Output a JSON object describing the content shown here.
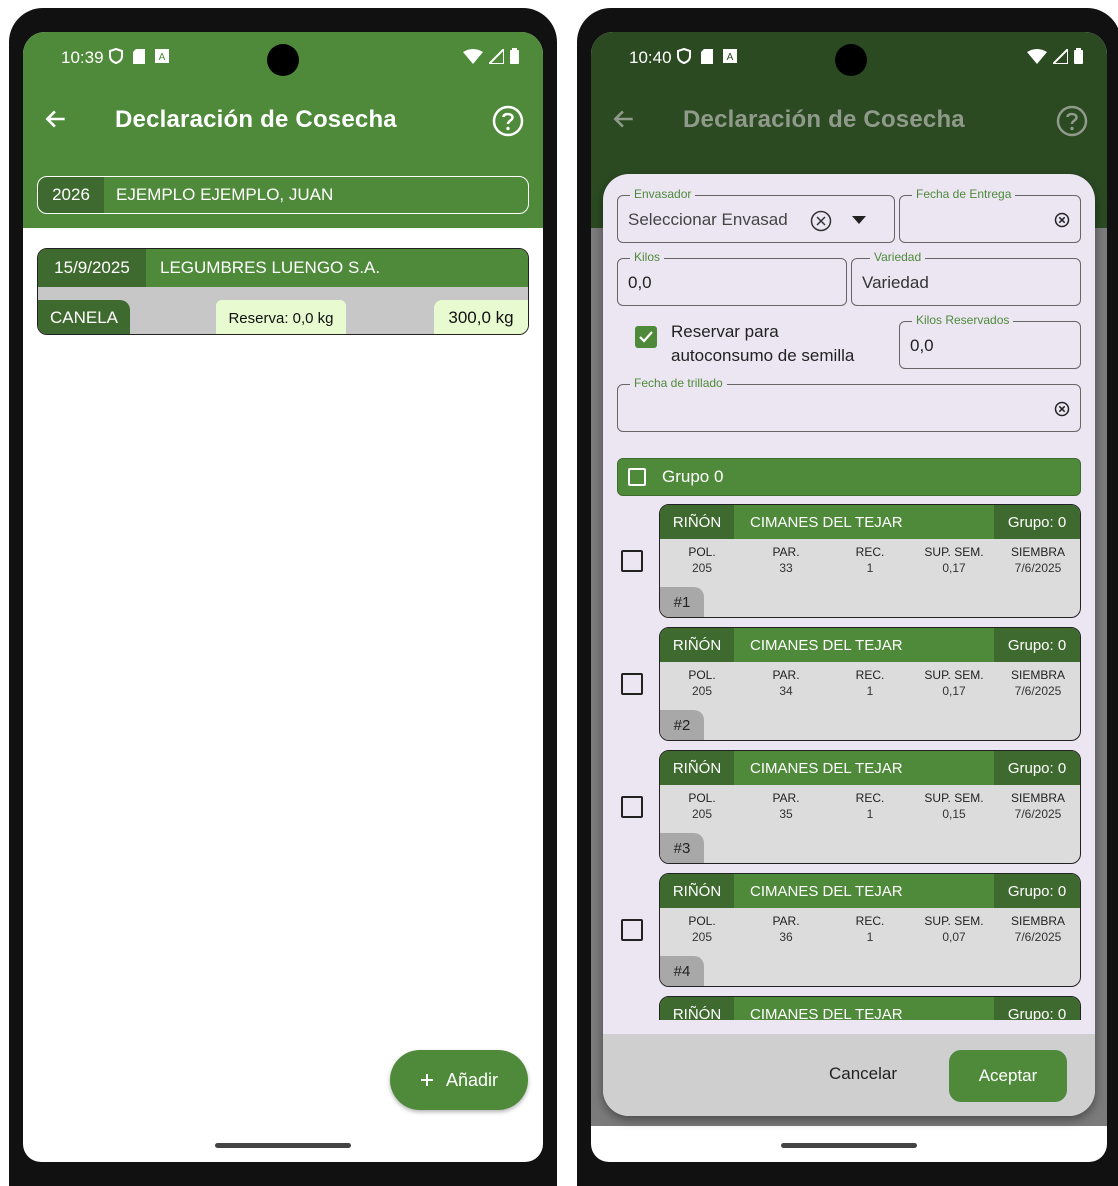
{
  "left": {
    "status": {
      "time": "10:39"
    },
    "appbar": {
      "title": "Declaración de Cosecha"
    },
    "campaign": {
      "year": "2026",
      "holder": "EJEMPLO EJEMPLO, JUAN"
    },
    "harvest": {
      "date": "15/9/2025",
      "company": "LEGUMBRES LUENGO S.A.",
      "variety": "CANELA",
      "reserve": "Reserva: 0,0 kg",
      "kilos": "300,0 kg"
    },
    "fab": {
      "label": "Añadir"
    }
  },
  "right": {
    "status": {
      "time": "10:40"
    },
    "appbar": {
      "title": "Declaración de Cosecha"
    },
    "dialog": {
      "packer": {
        "label": "Envasador",
        "value": "Seleccionar Envasad"
      },
      "delivery_date": {
        "label": "Fecha de Entrega",
        "value": ""
      },
      "kilos": {
        "label": "Kilos",
        "value": "0,0"
      },
      "variety": {
        "label": "Variedad",
        "value": "Variedad"
      },
      "reserve_checkbox": {
        "line1": "Reservar para",
        "line2": "autoconsumo de semilla",
        "checked": true
      },
      "reserved_kilos": {
        "label": "Kilos Reservados",
        "value": "0,0"
      },
      "threshing_date": {
        "label": "Fecha de trillado",
        "value": ""
      },
      "group": {
        "label": "Grupo 0"
      },
      "col_headers": [
        "POL.",
        "PAR.",
        "REC.",
        "SUP. SEM.",
        "SIEMBRA"
      ],
      "plots": [
        {
          "variety": "RIÑÓN",
          "location": "CIMANES DEL TEJAR",
          "group": "Grupo: 0",
          "values": [
            "205",
            "33",
            "1",
            "0,17",
            "7/6/2025"
          ],
          "number": "#1"
        },
        {
          "variety": "RIÑÓN",
          "location": "CIMANES DEL TEJAR",
          "group": "Grupo: 0",
          "values": [
            "205",
            "34",
            "1",
            "0,17",
            "7/6/2025"
          ],
          "number": "#2"
        },
        {
          "variety": "RIÑÓN",
          "location": "CIMANES DEL TEJAR",
          "group": "Grupo: 0",
          "values": [
            "205",
            "35",
            "1",
            "0,15",
            "7/6/2025"
          ],
          "number": "#3"
        },
        {
          "variety": "RIÑÓN",
          "location": "CIMANES DEL TEJAR",
          "group": "Grupo: 0",
          "values": [
            "205",
            "36",
            "1",
            "0,07",
            "7/6/2025"
          ],
          "number": "#4"
        },
        {
          "variety": "RIÑÓN",
          "location": "CIMANES DEL TEJAR",
          "group": "Grupo: 0",
          "values": [
            "",
            "",
            "",
            "",
            ""
          ],
          "number": ""
        }
      ],
      "cancel": "Cancelar",
      "accept": "Aceptar"
    }
  },
  "colors": {
    "primary": "#4e8a3a",
    "primary_dark": "#3f6a2f",
    "highlight": "#e8fbd0",
    "dialog_bg": "#ece6f3"
  }
}
